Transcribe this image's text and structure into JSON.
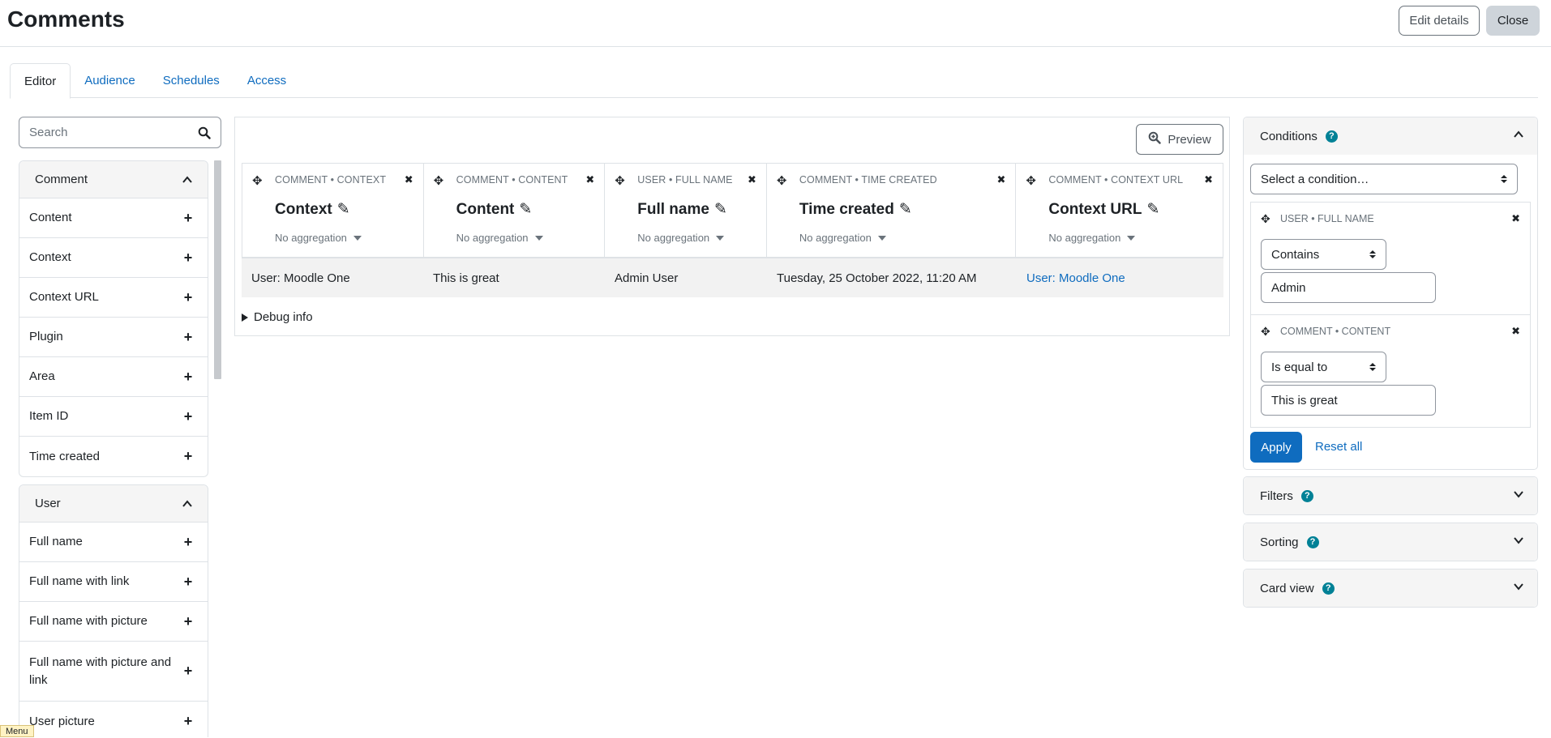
{
  "header": {
    "title": "Comments",
    "edit_details": "Edit details",
    "close": "Close"
  },
  "tabs": [
    {
      "label": "Editor"
    },
    {
      "label": "Audience"
    },
    {
      "label": "Schedules"
    },
    {
      "label": "Access"
    }
  ],
  "sidebar": {
    "search_placeholder": "Search",
    "groups": [
      {
        "title": "Comment",
        "items": [
          "Content",
          "Context",
          "Context URL",
          "Plugin",
          "Area",
          "Item ID",
          "Time created"
        ]
      },
      {
        "title": "User",
        "items": [
          "Full name",
          "Full name with link",
          "Full name with picture",
          "Full name with picture and link",
          "User picture"
        ]
      }
    ]
  },
  "report": {
    "preview": "Preview",
    "columns": [
      {
        "kind": "COMMENT • CONTEXT",
        "title": "Context",
        "aggregation": "No aggregation"
      },
      {
        "kind": "COMMENT • CONTENT",
        "title": "Content",
        "aggregation": "No aggregation"
      },
      {
        "kind": "USER • FULL NAME",
        "title": "Full name",
        "aggregation": "No aggregation"
      },
      {
        "kind": "COMMENT • TIME CREATED",
        "title": "Time created",
        "aggregation": "No aggregation"
      },
      {
        "kind": "COMMENT • CONTEXT URL",
        "title": "Context URL",
        "aggregation": "No aggregation"
      }
    ],
    "row": [
      "User: Moodle One",
      "This is great",
      "Admin User",
      "Tuesday, 25 October 2022, 11:20 AM",
      "User: Moodle One"
    ],
    "debug": "Debug info"
  },
  "conditions": {
    "title": "Conditions",
    "select_placeholder": "Select a condition…",
    "items": [
      {
        "kind": "USER • FULL NAME",
        "operator": "Contains",
        "value": "Admin"
      },
      {
        "kind": "COMMENT • CONTENT",
        "operator": "Is equal to",
        "value": "This is great"
      }
    ],
    "apply": "Apply",
    "reset": "Reset all"
  },
  "panels": {
    "filters": "Filters",
    "sorting": "Sorting",
    "card_view": "Card view"
  },
  "footer": {
    "menu": "Menu"
  },
  "colors": {
    "link": "#0f6cbf",
    "help": "#008196",
    "primary": "#0f6cbf"
  }
}
